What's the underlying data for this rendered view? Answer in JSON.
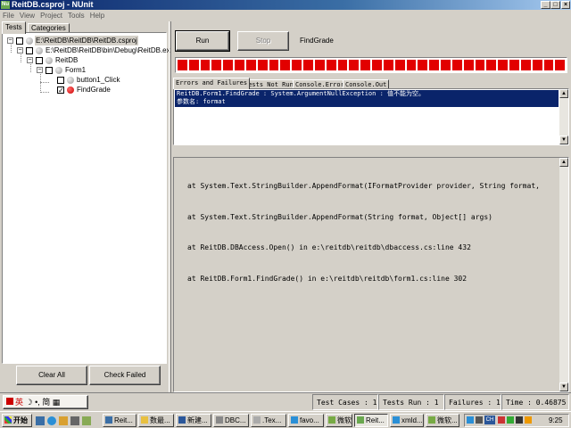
{
  "window": {
    "title": "ReitDB.csproj - NUnit",
    "app_icon": "Nu"
  },
  "menu": [
    "File",
    "View",
    "Project",
    "Tools",
    "Help"
  ],
  "left_tabs": [
    "Tests",
    "Categories"
  ],
  "tree": [
    {
      "label": "E:\\ReitDB\\ReitDB\\ReitDB.csproj",
      "state": "gray"
    },
    {
      "label": "E:\\ReitDB\\ReitDB\\bin\\Debug\\ReitDB.ex",
      "state": "gray"
    },
    {
      "label": "ReitDB",
      "state": "gray"
    },
    {
      "label": "Form1",
      "state": "gray"
    },
    {
      "label": "button1_Click",
      "state": "gray"
    },
    {
      "label": "FindGrade",
      "state": "red"
    }
  ],
  "left_buttons": {
    "clear_all": "Clear All",
    "check_failed": "Check Failed"
  },
  "run_panel": {
    "run": "Run",
    "stop": "Stop",
    "current_test": "FindGrade"
  },
  "progress": {
    "fraction": 1.0,
    "color": "#e20000",
    "segments": 34
  },
  "result_tabs": [
    "Errors and Failures",
    "Tests Not Run",
    "Console.Error",
    "Console.Out"
  ],
  "errors": [
    "ReitDB.Form1.FindGrade : System.ArgumentNullException : 值不能为空。",
    "参数名: format"
  ],
  "stack_trace": [
    "at System.Text.StringBuilder.AppendFormat(IFormatProvider provider, String format,",
    "at System.Text.StringBuilder.AppendFormat(String format, Object[] args)",
    "at ReitDB.DBAccess.Open() in e:\\reitdb\\reitdb\\dbaccess.cs:line 432",
    "at ReitDB.Form1.FindGrade() in e:\\reitdb\\reitdb\\form1.cs:line 302"
  ],
  "status": {
    "ime": "英",
    "test_cases": "Test Cases : 1",
    "tests_run": "Tests Run : 1",
    "failures": "Failures : 1",
    "time": "Time : 0.46875"
  },
  "taskbar": {
    "start": "开始",
    "tasks": [
      "Reit...",
      "数最...",
      "新建...",
      "DBC...",
      ".Tex...",
      "favo...",
      "微软...",
      "Reit...",
      "xmld...",
      "微软..."
    ],
    "clock": "9:25"
  }
}
